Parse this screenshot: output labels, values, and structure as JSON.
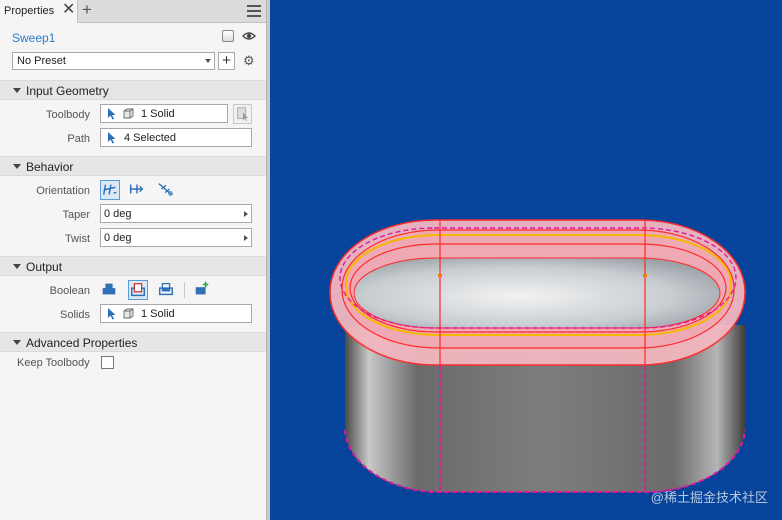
{
  "tabs": {
    "active": "Properties",
    "close_symbol": "✕",
    "add_symbol": "+"
  },
  "feature": {
    "name": "Sweep1"
  },
  "preset": {
    "value": "No Preset",
    "add_symbol": "+",
    "gear_symbol": "⚙"
  },
  "sections": {
    "input_geometry": {
      "title": "Input Geometry",
      "toolbody_label": "Toolbody",
      "toolbody_value": "1 Solid",
      "path_label": "Path",
      "path_value": "4 Selected"
    },
    "behavior": {
      "title": "Behavior",
      "orientation_label": "Orientation",
      "taper_label": "Taper",
      "taper_value": "0 deg",
      "twist_label": "Twist",
      "twist_value": "0 deg"
    },
    "output": {
      "title": "Output",
      "boolean_label": "Boolean",
      "solids_label": "Solids",
      "solids_value": "1 Solid"
    },
    "advanced": {
      "title": "Advanced Properties",
      "keep_toolbody_label": "Keep Toolbody",
      "keep_toolbody_checked": false
    }
  },
  "viewport": {
    "background": "#05449a",
    "highlight_color": "#ff2a2a",
    "path_color": "#e0199a",
    "watermark": "@稀土掘金技术社区"
  },
  "colors": {
    "accent": "#2b7bc8",
    "selected_border": "#5b9bd5"
  }
}
